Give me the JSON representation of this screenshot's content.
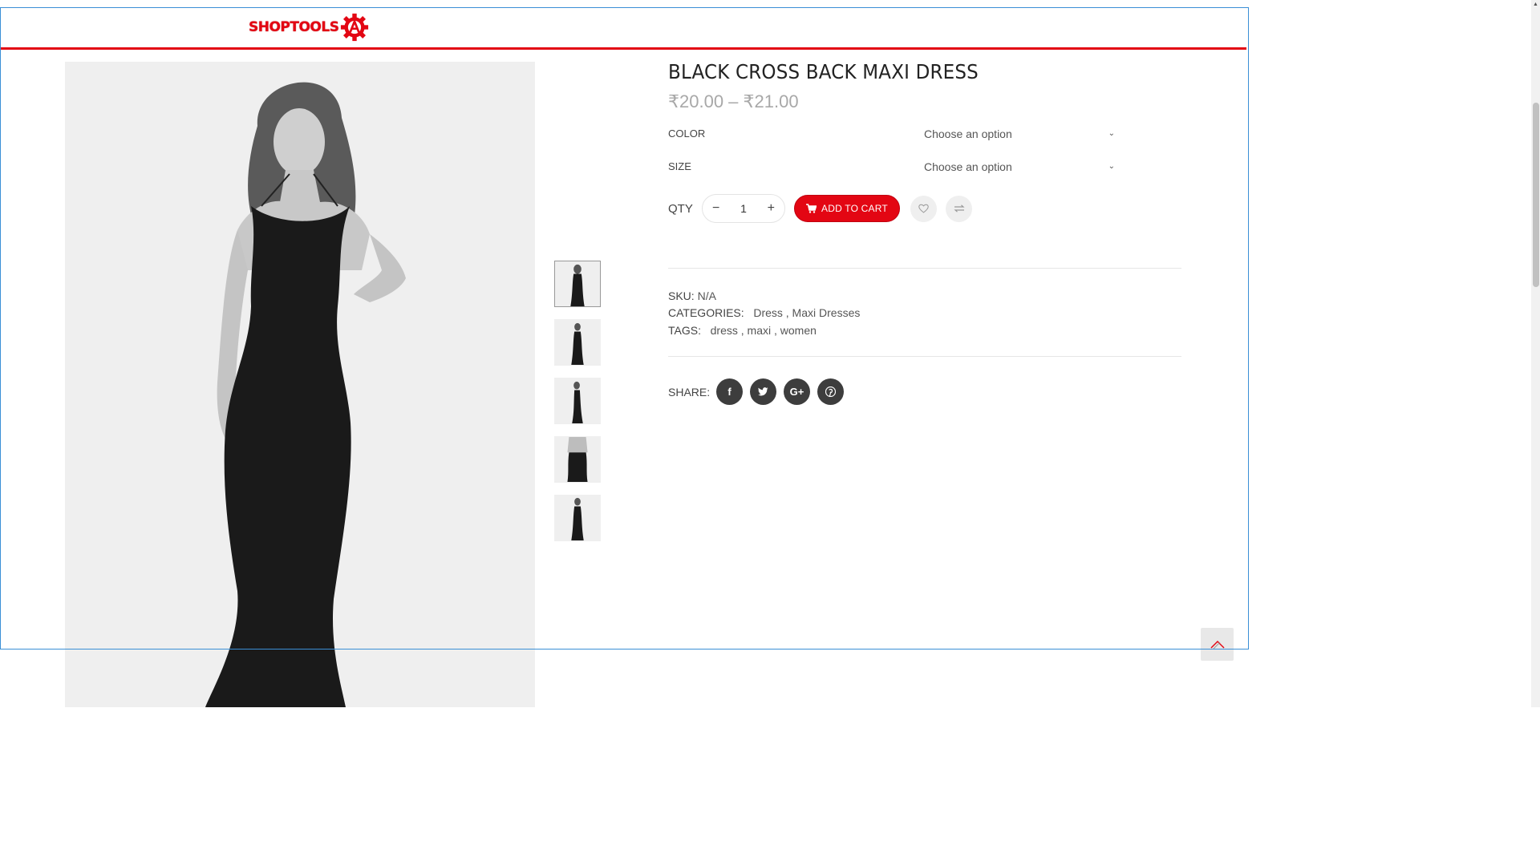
{
  "header": {
    "logo_text": "SHOPTOOLS",
    "logo_letter": "A",
    "brand_color": "#e30613"
  },
  "product": {
    "title": "BLACK CROSS BACK MAXI DRESS",
    "price": "₹20.00 – ₹21.00",
    "variations": [
      {
        "label": "COLOR",
        "value": "Choose an option"
      },
      {
        "label": "SIZE",
        "value": "Choose an option"
      }
    ],
    "qty_label": "QTY",
    "qty_value": "1",
    "qty_minus": "−",
    "qty_plus": "+",
    "add_to_cart": "ADD TO CART",
    "sku_label": "SKU:",
    "sku_value": "N/A",
    "categories_label": "CATEGORIES:",
    "categories_value": "Dress , Maxi Dresses",
    "tags_label": "TAGS:",
    "tags_value": "dress , maxi , women",
    "share_label": "SHARE:"
  },
  "icons": {
    "chevron": "chevron-down-icon",
    "cart": "cart-icon",
    "wishlist": "heart-icon",
    "compare": "compare-icon",
    "social": [
      "facebook-icon",
      "twitter-icon",
      "google-plus-icon",
      "pinterest-icon"
    ]
  },
  "social_glyphs": {
    "facebook": "f",
    "twitter": "t",
    "google": "G+",
    "pinterest": "P"
  },
  "thumbnails": 5
}
